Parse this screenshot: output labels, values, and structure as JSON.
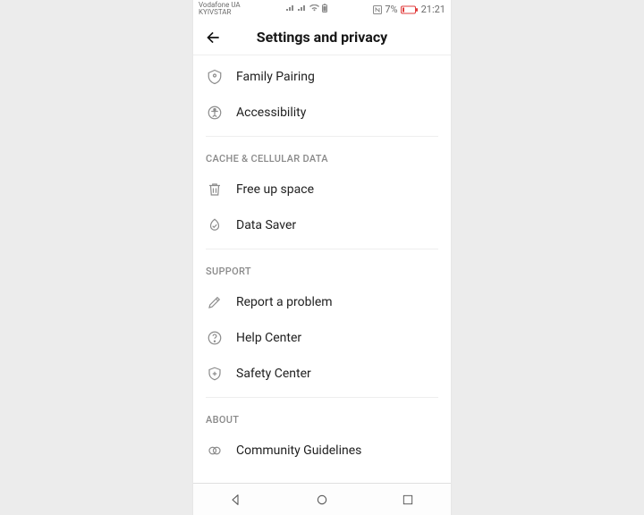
{
  "status": {
    "carrier1": "Vodafone UA",
    "carrier2": "KYIVSTAR",
    "battery_pct": "7%",
    "time": "21:21"
  },
  "header": {
    "title": "Settings and privacy"
  },
  "groups": [
    {
      "title": null,
      "items": [
        {
          "icon": "family",
          "label": "Family Pairing"
        },
        {
          "icon": "accessibility",
          "label": "Accessibility"
        }
      ]
    },
    {
      "title": "CACHE & CELLULAR DATA",
      "items": [
        {
          "icon": "trash",
          "label": "Free up space"
        },
        {
          "icon": "datasaver",
          "label": "Data Saver"
        }
      ]
    },
    {
      "title": "SUPPORT",
      "items": [
        {
          "icon": "pencil",
          "label": "Report a problem"
        },
        {
          "icon": "help",
          "label": "Help Center"
        },
        {
          "icon": "shield",
          "label": "Safety Center"
        }
      ]
    },
    {
      "title": "ABOUT",
      "items": [
        {
          "icon": "guidelines",
          "label": "Community Guidelines"
        }
      ]
    }
  ]
}
